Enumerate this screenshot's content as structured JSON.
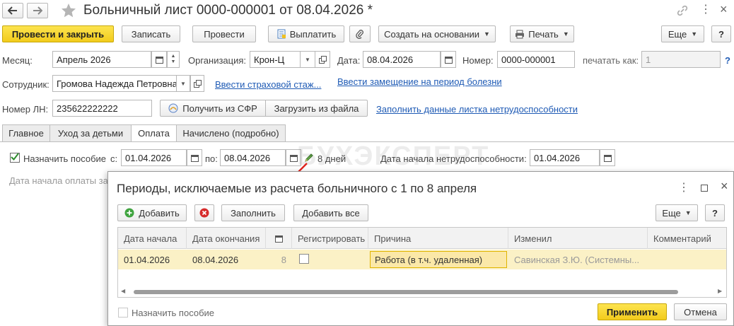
{
  "window": {
    "title": "Больничный лист 0000-000001 от 08.04.2026 *",
    "watermark": "БУХЭКСПЕРТ"
  },
  "toolbar": {
    "post_close": "Провести и закрыть",
    "save": "Записать",
    "post": "Провести",
    "pay": "Выплатить",
    "create_based": "Создать на основании",
    "print": "Печать",
    "more": "Еще",
    "help": "?"
  },
  "form": {
    "month_label": "Месяц:",
    "month_value": "Апрель 2026",
    "org_label": "Организация:",
    "org_value": "Крон-Ц",
    "date_label": "Дата:",
    "date_value": "08.04.2026",
    "number_label": "Номер:",
    "number_value": "0000-000001",
    "print_as_label": "печатать как:",
    "print_as_value": "1",
    "help_q": "?",
    "employee_label": "Сотрудник:",
    "employee_value": "Громова Надежда Петровна",
    "insurance_link": "Ввести страховой стаж...",
    "replacement_link": "Ввести замещение на период болезни",
    "ln_label": "Номер ЛН:",
    "ln_value": "235622222222",
    "get_sfr": "Получить из СФР",
    "load_file": "Загрузить из файла",
    "fill_link": "Заполнить данные листка нетрудоспособности"
  },
  "tabs": [
    "Главное",
    "Уход за детьми",
    "Оплата",
    "Начислено (подробно)"
  ],
  "payment": {
    "assign_label": "Назначить пособие",
    "from_label": "с:",
    "from_value": "01.04.2026",
    "to_label": "по:",
    "to_value": "08.04.2026",
    "days": "8 дней",
    "start_label": "Дата начала нетрудоспособности:",
    "start_value": "01.04.2026",
    "pay_start_label": "Дата начала оплаты за"
  },
  "dialog": {
    "title": "Периоды, исключаемые из расчета больничного с 1 по 8 апреля",
    "add": "Добавить",
    "fill": "Заполнить",
    "add_all": "Добавить все",
    "more": "Еще",
    "help": "?",
    "columns": [
      "Дата начала",
      "Дата окончания",
      "",
      "Регистрировать",
      "Причина",
      "Изменил",
      "Комментарий"
    ],
    "rows": [
      {
        "start": "01.04.2026",
        "end": "08.04.2026",
        "days": "8",
        "register": false,
        "reason": "Работа (в т.ч. удаленная)",
        "changed_by": "Савинская З.Ю. (Системны...",
        "comment": ""
      }
    ],
    "assign_benefit": "Назначить пособие",
    "apply": "Применить",
    "cancel": "Отмена"
  },
  "colors": {
    "accent_yellow": "#f5d327",
    "row_highlight": "#fbf1c6",
    "link_blue": "#1f5bb5",
    "red_arrow": "#e0231c"
  },
  "icons": [
    "back-arrow-icon",
    "forward-arrow-icon",
    "star-icon",
    "link-icon",
    "more-icon",
    "maximize-icon",
    "close-icon",
    "calendar-icon",
    "open-icon",
    "pencil-icon",
    "printer-icon",
    "paperclip-icon",
    "document-icon",
    "add-icon",
    "delete-icon"
  ]
}
